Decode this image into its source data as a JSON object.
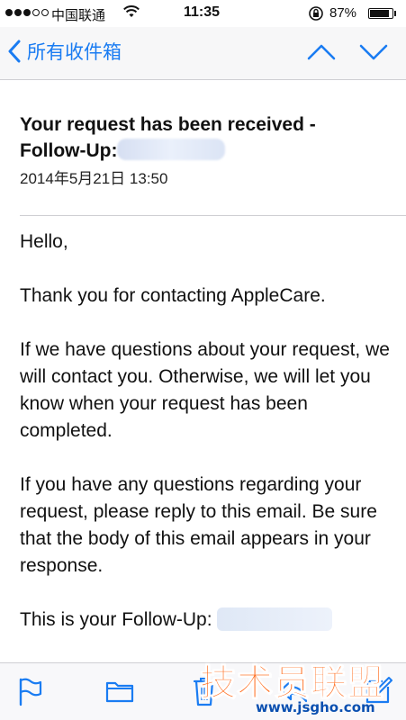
{
  "status_bar": {
    "carrier": "中国联通",
    "time": "11:35",
    "battery_percent": "87%",
    "battery_level": 0.87,
    "signal_strength": 3,
    "signal_max": 5
  },
  "nav": {
    "back_label": "所有收件箱"
  },
  "email": {
    "subject_line1": "Your request has been received -",
    "subject_line2_prefix": "Follow-Up:",
    "date": "2014年5月21日 13:50",
    "body": {
      "greeting": "Hello,",
      "thanks": "Thank you for contacting AppleCare.",
      "p2": "If we have questions about your request, we will contact you. Otherwise, we will let you know when your request has been completed.",
      "p3": "If you have any questions regarding your request, please reply to this email. Be sure that the body of this email appears in your response.",
      "p4_partial": "This is your Follow-Up:"
    }
  },
  "toolbar": {
    "icons": [
      "flag-icon",
      "folder-icon",
      "trash-icon",
      "reply-icon",
      "compose-icon"
    ]
  },
  "watermark": {
    "title": "技术员联盟",
    "url": "www.jsgho.com"
  },
  "colors": {
    "accent": "#1a7cf2",
    "watermark_title": "#ff6a1a",
    "watermark_url": "#0a4fb0"
  }
}
